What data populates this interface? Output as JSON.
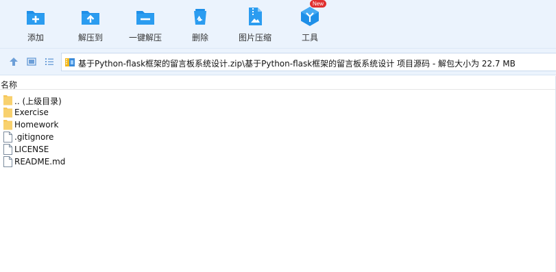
{
  "toolbar": {
    "items": [
      {
        "label": "添加"
      },
      {
        "label": "解压到"
      },
      {
        "label": "一键解压"
      },
      {
        "label": "删除"
      },
      {
        "label": "图片压缩"
      },
      {
        "label": "工具",
        "badge": "New"
      }
    ]
  },
  "nav": {
    "path": "基于Python-flask框架的留言板系统设计.zip\\基于Python-flask框架的留言板系统设计 项目源码 - 解包大小为 22.7 MB"
  },
  "list": {
    "column_name": "名称",
    "items": [
      {
        "name": ".. (上级目录)",
        "type": "folder"
      },
      {
        "name": "Exercise",
        "type": "folder"
      },
      {
        "name": "Homework",
        "type": "folder"
      },
      {
        "name": ".gitignore",
        "type": "file"
      },
      {
        "name": "LICENSE",
        "type": "file"
      },
      {
        "name": "README.md",
        "type": "file"
      }
    ]
  },
  "colors": {
    "accent": "#1e8fe8",
    "toolbar_bg": "#ebf3fd",
    "badge": "#e02f2f",
    "folder": "#f6c65a"
  }
}
